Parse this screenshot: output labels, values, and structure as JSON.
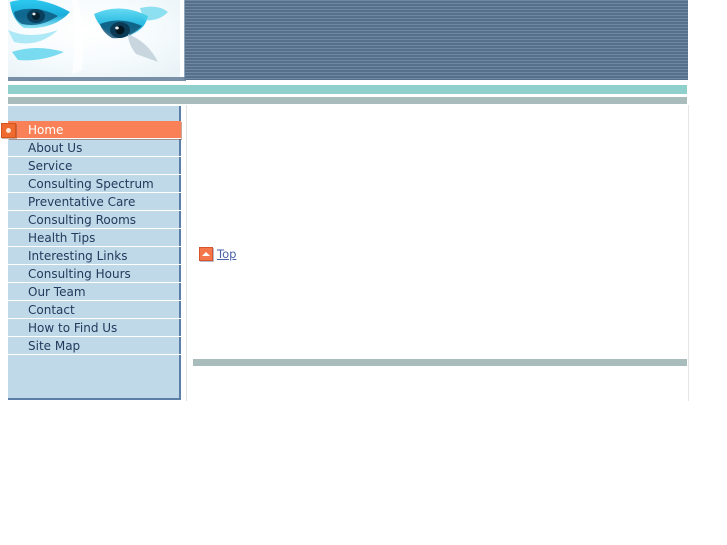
{
  "header": {
    "photo_alt": "close-up of a face with blue eye makeup",
    "banner_title": ""
  },
  "sidebar": {
    "items": [
      {
        "label": "Home",
        "active": true,
        "icon": "bullet-arrow-icon"
      },
      {
        "label": "About Us",
        "active": false
      },
      {
        "label": "Service",
        "active": false
      },
      {
        "label": "Consulting Spectrum",
        "active": false
      },
      {
        "label": "Preventative Care",
        "active": false
      },
      {
        "label": "Consulting Rooms",
        "active": false
      },
      {
        "label": "Health Tips",
        "active": false
      },
      {
        "label": "Interesting Links",
        "active": false
      },
      {
        "label": "Consulting Hours",
        "active": false
      },
      {
        "label": "Our Team",
        "active": false
      },
      {
        "label": "Contact",
        "active": false
      },
      {
        "label": "How to Find Us",
        "active": false
      },
      {
        "label": "Site Map",
        "active": false
      }
    ]
  },
  "main": {
    "top_link": {
      "label": "Top",
      "icon": "up-arrow-icon"
    },
    "body_text": ""
  },
  "colors": {
    "banner_blue": "#5b7795",
    "bar_teal": "#8fd0cc",
    "bar_gray": "#a8bdbb",
    "sidebar_bg": "#bfd9e8",
    "sidebar_border": "#5c7fa8",
    "active_orange": "#fa8157",
    "link_blue": "#4a63a8",
    "text_navy": "#233a5c"
  }
}
